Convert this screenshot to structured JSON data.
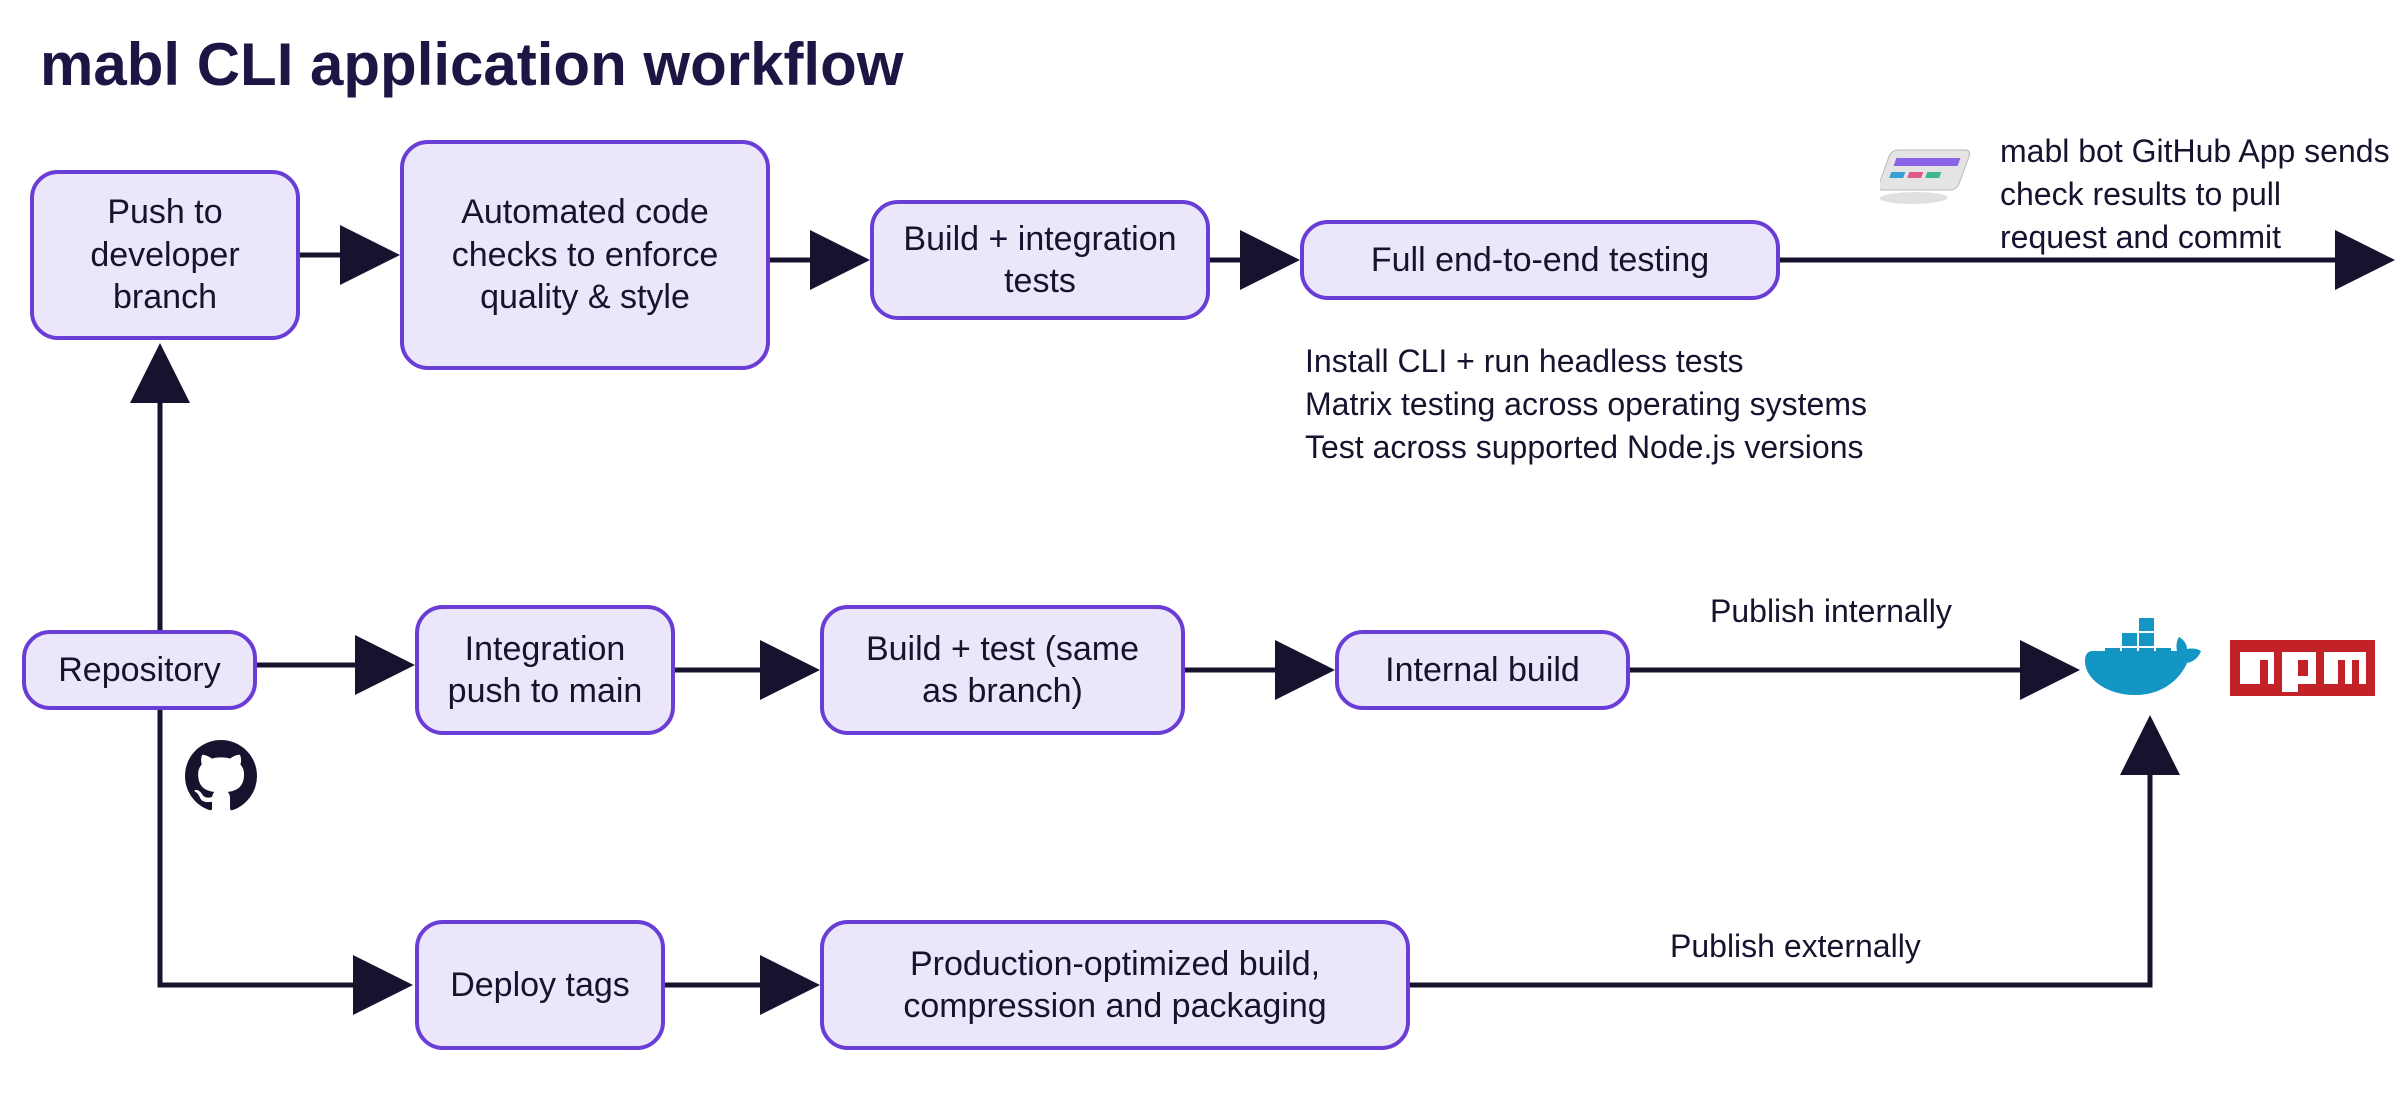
{
  "title": "mabl CLI application workflow",
  "nodes": {
    "push_dev": "Push to developer branch",
    "checks": "Automated code checks to enforce quality & style",
    "build_int": "Build + integration tests",
    "e2e": "Full end-to-end testing",
    "repo": "Repository",
    "int_push": "Integration push to main",
    "build_test": "Build + test (same as branch)",
    "internal": "Internal build",
    "deploy": "Deploy tags",
    "prod": "Production-optimized build, compression and packaging"
  },
  "annotations": {
    "bot": "mabl bot GitHub App sends check results to pull request and commit",
    "e2e_sub": "Install CLI + run headless tests\nMatrix testing across operating systems\nTest across supported Node.js versions",
    "pub_int": "Publish internally",
    "pub_ext": "Publish externally"
  },
  "icons": {
    "github": "github-icon",
    "mabl": "mabl-bot-icon",
    "docker": "docker-icon",
    "npm": "npm-icon"
  }
}
